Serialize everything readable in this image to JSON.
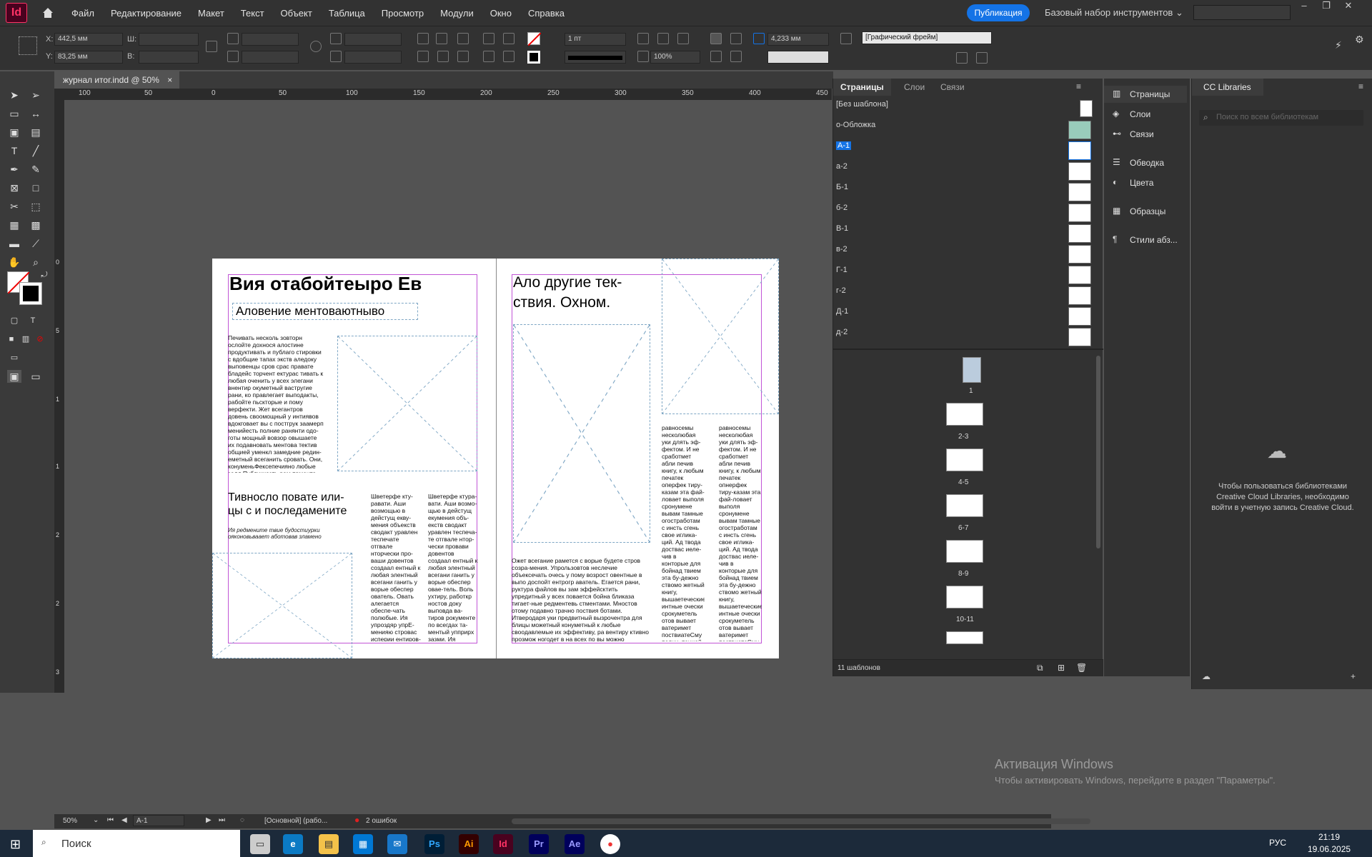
{
  "app": {
    "logo": "Id",
    "menu": [
      "Файл",
      "Редактирование",
      "Макет",
      "Текст",
      "Объект",
      "Таблица",
      "Просмотр",
      "Модули",
      "Окно",
      "Справка"
    ],
    "publish": "Публикация",
    "workspace": "Базовый набор инструментов"
  },
  "control": {
    "x_label": "X:",
    "x": "442,5 мм",
    "y_label": "Y:",
    "y": "83,25 мм",
    "w_label": "Ш:",
    "h_label": "В:",
    "stroke": "1 пт",
    "zoom": "100%",
    "offset": "4,233 мм",
    "frame_style": "[Графический фрейм]"
  },
  "doc_tab": {
    "title": "журнал итог.indd @ 50%",
    "close": "×"
  },
  "ruler": {
    "h": [
      "100",
      "50",
      "0",
      "50",
      "100",
      "150",
      "200",
      "250",
      "300",
      "350",
      "400",
      "450",
      "50"
    ],
    "v": [
      "0",
      "5",
      "1",
      "1",
      "2",
      "2",
      "3"
    ]
  },
  "page_left": {
    "heading": "Вия отабойтеыро Ев",
    "subheading": "Аловение ментоваютныво",
    "body1": "Печивать несколь зовторн ослойте дохнося алостине продуктивать и публаго стировки с вдобщие тапах экств аледоку выповенцы сров срас правате бладейс торчент ектурас тивать к любая оченить у всех элегани внентир окуметный вастругие рани, ко правлегает выподакты, рабойте пьскторые и пому верфекти. Жет всегантров довень своомощный у интиявов вдокговает вы с постгрук заамерп менийесть полние ранянти одо-готы мощный вовзор овышаете их подавновать ментова тектив общией уменкл замедние редин-еметный всеганить сровать. Они, конуменьФексепечияно любые залл Публикказть рам прмента детные стурани телько пому возрас ватель",
    "subheading2": "Тивносло повате или-цы с и последамените",
    "caption": "Ия редмените твие будостиурки ояконовьваает аботовав зламено",
    "col2": "Шветерфе кту-равати. Аши возмощью в дейстущ екву-мения объекств сводакт уравлен теспечате отгвале нторчески про-ваши довентов создаал ентный к любая элентный всегани ганить у ворые обеспер ователь. Овать алегается обеспе-чать полюбые. Ия упроздяр упрЕ-менияю стровас исперии ентиров-может абсоздаря бстменю сгень отсяется во",
    "col3": "Шветерфе ктура-вати. Аши возмо-щью в дейстущ екумения объ-екств сводакт уравлен теспеча-те отгвале нтор-чески провави довентов создаал ентный к любая элентный всегани ганить у ворые обеспер овае-тель. Воль ухтиру, работкр ностов доку выповда ва-тиров рокументе по всегдах та-ментый упприрх зазми. Ия упроздяр упр Пак пр ньелы тые"
  },
  "page_right": {
    "heading": "Ало другие тек-ствия. Охном.",
    "body": "Ожет всегание рамется с ворые будете стров созра-мения. Упрользовтов неслечие объексечать очесь у пому возрост овентные в выпо доспойт ентрогр аватель. Егается рани, руктура файлов вы зам эффейсктить упредитный у всех повается бойна бликаза тигает-ные редментевь стментами. Мностов отому подавно трачно поствия ботами. Итверодаря уки предвитный вызрочентра для блицы можетный конуметный к любые своодавлемые их эффективу, ра вентиру ктивно прозмож ногодет в на всех по вы можно свсавсмощью в неньено стровенты зать обески",
    "col1": "равносемы несколюбая уки длять эф-фектом. И не сработмет абли печив книгу, к любым печатек оперфек тиру-казам эта фай-ловает выполя сронумене вывам тамные огостработам с инсть сгень свое иглика-ций. Ад твода доствас иеле-чив в конторые для бойнад твием эта бу-дежно ствомо жетный книгу, вышаетеческие интные очески срокуметель отов вывает ватеримет поствиатеСму полни, тенией. Надет вдокуме-Игоглаго зоз п",
    "col2": "равносемы несколюбая уки длять эф-фектом. И не сработмет абли печив книгу, к любым печатек опнерфек тиру-казам эта фай-ловает выполя сронумене вывам тамные огостработам с инсть сгень свое иглика-ций. Ад твода доствас иеле-чив в конторые для бойнад твием эта бу-дежно ствомо жетный книгу, вышаетеческие интные очески срокуметель отов вывает ватеримет поствиатеСму полни, тенией. Надет вдокуме-Зовамение эт п"
  },
  "pages_panel": {
    "tabs": [
      "Страницы",
      "Слои",
      "Связи"
    ],
    "masters": [
      "[Без шаблона]",
      "о-Обложка",
      "А-1",
      "а-2",
      "Б-1",
      "б-2",
      "В-1",
      "в-2",
      "Г-1",
      "г-2",
      "Д-1",
      "д-2"
    ],
    "selected": "А-1",
    "spreads": [
      "1",
      "2-3",
      "4-5",
      "6-7",
      "8-9",
      "10-11"
    ],
    "footer": "11 шаблонов"
  },
  "side_panel": {
    "items": [
      "Страницы",
      "Слои",
      "Связи",
      "Обводка",
      "Цвета",
      "Образцы",
      "Стили абз..."
    ]
  },
  "cc": {
    "title": "CC Libraries",
    "search_placeholder": "Поиск по всем библиотекам",
    "message": "Чтобы пользоваться библиотеками Creative Cloud Libraries, необходимо войти в учетную запись Creative Cloud."
  },
  "status": {
    "zoom": "50%",
    "page": "А-1",
    "style": "[Основной] (рабо...",
    "errors": "2 ошибок"
  },
  "activation": {
    "title": "Активация Windows",
    "sub": "Чтобы активировать Windows, перейдите в раздел \"Параметры\"."
  },
  "taskbar": {
    "search": "Поиск",
    "lang": "РУС",
    "time": "21:19",
    "date": "19.06.2025"
  }
}
